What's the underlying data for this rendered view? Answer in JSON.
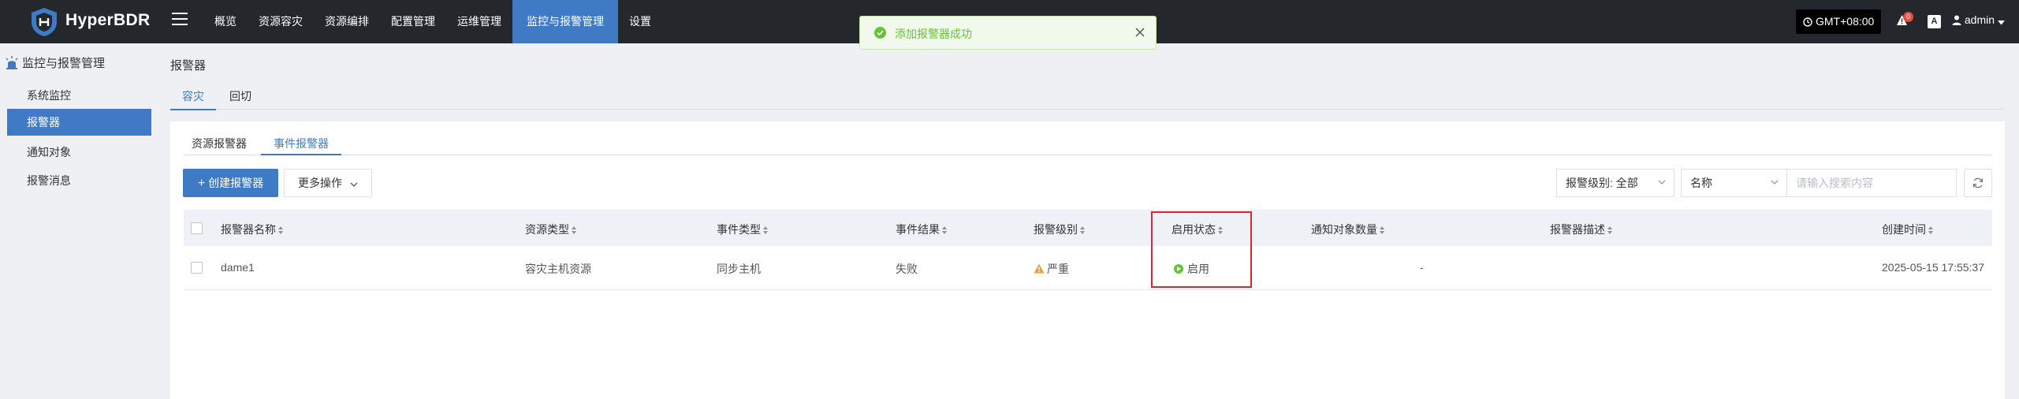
{
  "app": {
    "brand": "HyperBDR"
  },
  "nav": {
    "items": [
      "概览",
      "资源容灾",
      "资源编排",
      "配置管理",
      "运维管理",
      "监控与报警管理",
      "设置"
    ],
    "active_index": 5
  },
  "header": {
    "timezone": "GMT+08:00",
    "alert_count": "0",
    "translate_label": "A",
    "user": "admin"
  },
  "toast": {
    "message": "添加报警器成功",
    "type": "success"
  },
  "sidebar": {
    "title": "监控与报警管理",
    "items": [
      "系统监控",
      "报警器",
      "通知对象",
      "报警消息"
    ],
    "active_index": 1
  },
  "page": {
    "title": "报警器"
  },
  "top_tabs": {
    "items": [
      "容灾",
      "回切"
    ],
    "active_index": 0
  },
  "inner_tabs": {
    "items": [
      "资源报警器",
      "事件报警器"
    ],
    "active_index": 1
  },
  "toolbar": {
    "create_label": "创建报警器",
    "more_label": "更多操作",
    "level_filter": "报警级别: 全部",
    "field_select": "名称",
    "search_placeholder": "请输入搜索内容"
  },
  "table": {
    "columns": [
      "报警器名称",
      "资源类型",
      "事件类型",
      "事件结果",
      "报警级别",
      "启用状态",
      "通知对象数量",
      "报警器描述",
      "创建时间"
    ],
    "rows": [
      {
        "name": "dame1",
        "resource_type": "容灾主机资源",
        "event_type": "同步主机",
        "event_result": "失败",
        "level": "严重",
        "status": "启用",
        "notify_count": "-",
        "description": "",
        "created": "2025-05-15 17:55:37"
      }
    ]
  },
  "colors": {
    "primary": "#3e7bc4",
    "topbar": "#24282d",
    "success": "#67c23a",
    "warning": "#e6a23c",
    "highlight": "#e0242c"
  }
}
